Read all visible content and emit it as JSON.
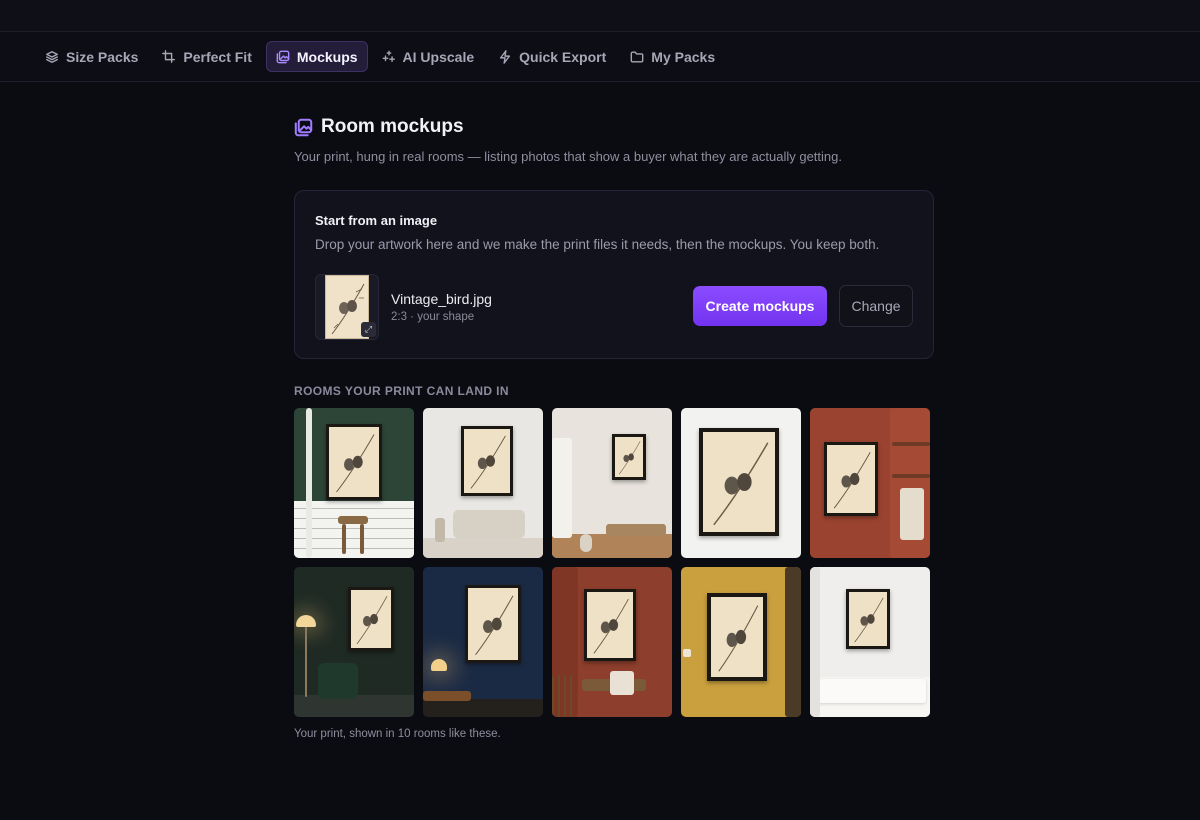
{
  "nav": {
    "tabs": [
      {
        "label": "Size Packs",
        "icon": "layers-icon",
        "active": false
      },
      {
        "label": "Perfect Fit",
        "icon": "crop-icon",
        "active": false
      },
      {
        "label": "Mockups",
        "icon": "images-icon",
        "active": true
      },
      {
        "label": "AI Upscale",
        "icon": "sparkles-icon",
        "active": false
      },
      {
        "label": "Quick Export",
        "icon": "bolt-icon",
        "active": false
      },
      {
        "label": "My Packs",
        "icon": "folder-icon",
        "active": false
      }
    ]
  },
  "page": {
    "title": "Room mockups",
    "subtitle": "Your print, hung in real rooms — listing photos that show a buyer what they are actually getting."
  },
  "upload_card": {
    "title": "Start from an image",
    "description": "Drop your artwork here and we make the print files it needs, then the mockups. You keep both.",
    "file_name": "Vintage_bird.jpg",
    "file_meta": "2:3 · your shape",
    "primary_button": "Create mockups",
    "secondary_button": "Change"
  },
  "rooms": {
    "section_label": "ROOMS YOUR PRINT CAN LAND IN",
    "tiles": [
      {
        "wall": "#2c4536",
        "style": "bathroom"
      },
      {
        "wall": "#e9e7e3",
        "style": "living-sofa"
      },
      {
        "wall": "#e8e4dd",
        "style": "hallway"
      },
      {
        "wall": "#f2f2f0",
        "style": "closeup"
      },
      {
        "wall": "#9a4330",
        "style": "kitchen-shelf"
      },
      {
        "wall": "#1f2a24",
        "style": "lamp-chair"
      },
      {
        "wall": "#1b2a44",
        "style": "night-lamp"
      },
      {
        "wall": "#8d3e2c",
        "style": "staircase"
      },
      {
        "wall": "#caa03e",
        "style": "mustard"
      },
      {
        "wall": "#efeeec",
        "style": "bedroom"
      }
    ],
    "caption": "Your print, shown in 10 rooms like these."
  },
  "colors": {
    "accent": "#7c3aed",
    "background": "#0b0b12"
  }
}
